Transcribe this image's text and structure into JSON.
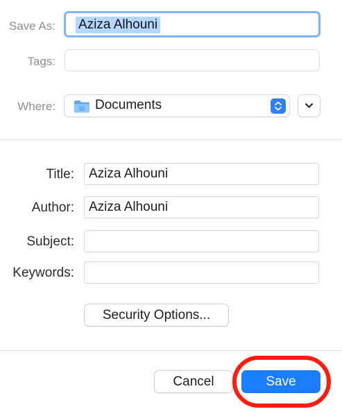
{
  "dialog": {
    "save_as_label": "Save As:",
    "save_as_value": "Aziza Alhouni",
    "tags_label": "Tags:",
    "tags_value": "",
    "where_label": "Where:",
    "where_value": "Documents",
    "where_icon": "folder-icon"
  },
  "metadata": {
    "title_label": "Title:",
    "title_value": "Aziza Alhouni",
    "author_label": "Author:",
    "author_value": "Aziza Alhouni",
    "subject_label": "Subject:",
    "subject_value": "",
    "keywords_label": "Keywords:",
    "keywords_value": "",
    "security_button": "Security Options..."
  },
  "footer": {
    "cancel_label": "Cancel",
    "save_label": "Save"
  },
  "colors": {
    "accent": "#1a7cff",
    "selection": "#b3d7ff",
    "highlight_ring": "#ff1d0d"
  }
}
